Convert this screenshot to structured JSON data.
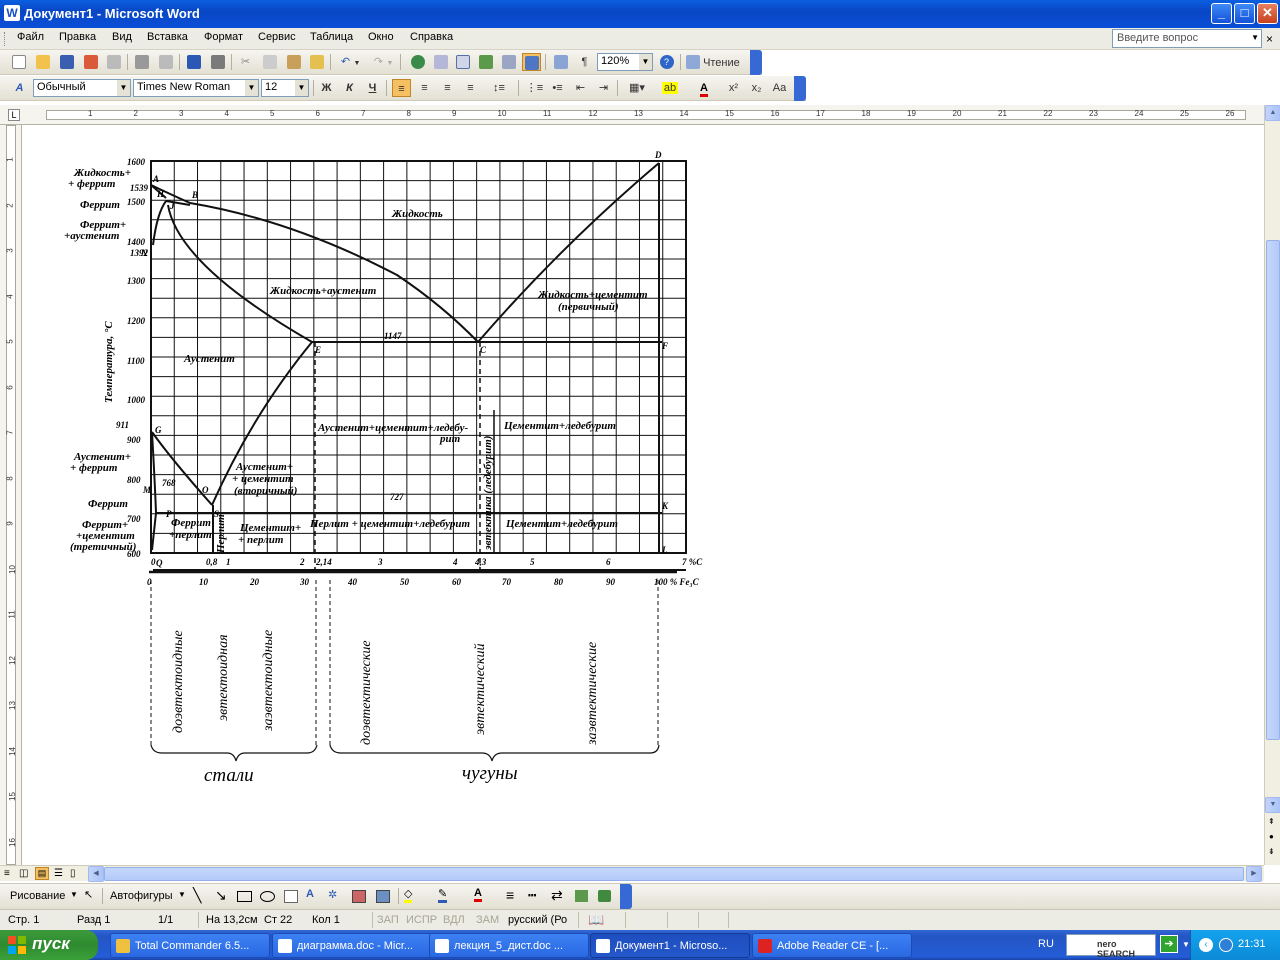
{
  "window": {
    "title": "Документ1 - Microsoft Word",
    "min": "_",
    "max": "□",
    "close": "✕"
  },
  "menu": {
    "items": [
      "Файл",
      "Правка",
      "Вид",
      "Вставка",
      "Формат",
      "Сервис",
      "Таблица",
      "Окно",
      "Справка"
    ],
    "help_placeholder": "Введите вопрос",
    "close": "×"
  },
  "toolbar": {
    "zoom": "120%",
    "reading": "Чтение",
    "pilcrow": "¶"
  },
  "format": {
    "style": "Обычный",
    "font": "Times New Roman",
    "size": "12",
    "bold": "Ж",
    "italic": "К",
    "underline": "Ч"
  },
  "ruler_h": [
    "1",
    "2",
    "3",
    "4",
    "5",
    "6",
    "7",
    "8",
    "9",
    "10",
    "11",
    "12",
    "13",
    "14",
    "15",
    "16",
    "17",
    "18",
    "19",
    "20",
    "21",
    "22",
    "23",
    "24",
    "25",
    "26"
  ],
  "ruler_v": [
    "1",
    "2",
    "3",
    "4",
    "5",
    "6",
    "7",
    "8",
    "9",
    "10",
    "11",
    "12",
    "13",
    "14",
    "15",
    "16"
  ],
  "diagram": {
    "temp_labels": [
      "1600",
      "1500",
      "1400",
      "1300",
      "1200",
      "1100",
      "1000",
      "900",
      "800",
      "700",
      "600"
    ],
    "extra_temps": [
      "1539",
      "1392",
      "911",
      "768",
      "727",
      "1147"
    ],
    "point_letters": [
      "A",
      "B",
      "H",
      "J",
      "N",
      "D",
      "E",
      "C",
      "F",
      "G",
      "S",
      "K",
      "P",
      "Q",
      "L",
      "M",
      "O"
    ],
    "axis_title": "Температура, °C",
    "axis_c_ticks": [
      "0",
      "0,8",
      "1",
      "2",
      "2,14",
      "3",
      "4",
      "4,3",
      "5",
      "6",
      "7 %C"
    ],
    "axis_fe3c_ticks": [
      "0",
      "10",
      "20",
      "30",
      "40",
      "50",
      "60",
      "70",
      "80",
      "90",
      "100 % Fe₃C"
    ],
    "regions": {
      "liquid": "Жидкость",
      "liq_ferrite": "Жидкость+",
      "liq_ferrite2": "+ феррит",
      "ferrite": "Феррит",
      "ferrite_aus1": "Феррит+",
      "ferrite_aus2": "+аустенит",
      "liq_aus": "Жидкость+аустенит",
      "liq_cem1": "Жидкость+цементит",
      "liq_cem2": "(первичный)",
      "austenite": "Аустенит",
      "aus_fer1": "Аустенит+",
      "aus_fer2": "+ феррит",
      "ferrite2": "Феррит",
      "fer_cem1": "Феррит+",
      "fer_cem2": "+цементит",
      "fer_cem3": "(третичный)",
      "fer_pearl1": "Феррит",
      "fer_pearl2": "+перлит",
      "pearlite": "Перлит",
      "aus_cem1": "Аустенит+",
      "aus_cem2": "+ цементит",
      "aus_cem3": "(вторичный)",
      "cem_pearl1": "Цементит+",
      "cem_pearl2": "+ перлит",
      "aus_cem_led1": "Аустенит+цементит+ледебу-",
      "aus_cem_led2": "рит",
      "cem_led_top": "Цементит+ледебурит",
      "pearl_cem_led": "Перлит + цементит+ледебурит",
      "cem_led_bot": "Цементит+ледебурит",
      "eutectic": "эвтектика (ледебурит)"
    },
    "categories": {
      "hypoeutectoid": "доэвтектоидные",
      "eutectoid": "эвтектоидная",
      "hypereutectoid": "заэвтектоидные",
      "hypoeutectic": "доэвтектические",
      "eutectic": "эвтектический",
      "hypereutectic": "заэвтектические",
      "steels": "стали",
      "cast_irons": "чугуны"
    }
  },
  "drawing_bar": {
    "draw": "Рисование",
    "autoshapes": "Автофигуры"
  },
  "status": {
    "page": "Стр. 1",
    "section": "Разд 1",
    "pages": "1/1",
    "at": "На 13,2см",
    "line": "Ст 22",
    "col": "Кол 1",
    "rec": "ЗАП",
    "trk": "ИСПР",
    "ext": "ВДЛ",
    "ovr": "ЗАМ",
    "lang": "русский (Ро"
  },
  "taskbar": {
    "start": "пуск",
    "tasks": [
      "Total Commander 6.5...",
      "диаграмма.doc - Micr...",
      "лекция_5_дист.doc ...",
      "Документ1 - Microso...",
      "Adobe Reader CE - [..."
    ],
    "lang": "RU",
    "nero": "nero SEARCH",
    "clock": "21:31"
  },
  "colors": {
    "title_blue": "#0a5fe0",
    "taskbar_blue": "#245dd7",
    "start_green": "#3c9a3c",
    "tray_blue": "#14a3ee"
  }
}
